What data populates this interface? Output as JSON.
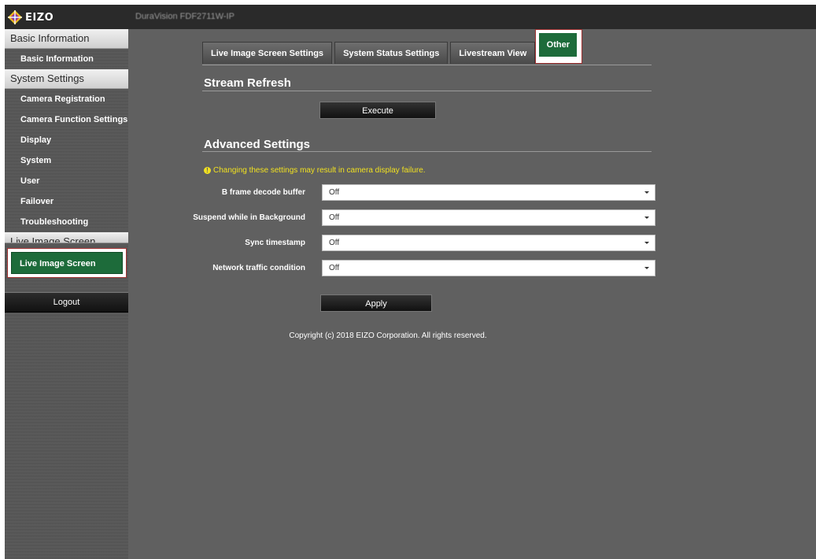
{
  "header": {
    "logo_text": "EIZO",
    "device_name": "DuraVision FDF2711W-IP"
  },
  "sidebar": {
    "sections": [
      {
        "title": "Basic Information",
        "items": [
          "Basic Information"
        ]
      },
      {
        "title": "System Settings",
        "items": [
          "Camera Registration",
          "Camera Function Settings",
          "Display",
          "System",
          "User",
          "Failover",
          "Troubleshooting"
        ]
      },
      {
        "title": "Live Image Screen Settings",
        "items": [
          "Live Image Screen"
        ]
      }
    ],
    "logout_label": "Logout"
  },
  "tabs": [
    "Live Image Screen Settings",
    "System Status Settings",
    "Livestream View",
    "Other"
  ],
  "stream_refresh": {
    "title": "Stream Refresh",
    "execute_label": "Execute"
  },
  "advanced": {
    "title": "Advanced Settings",
    "warning": "Changing these settings may result in camera display failure.",
    "rows": [
      {
        "label": "B frame decode buffer",
        "value": "Off"
      },
      {
        "label": "Suspend while in Background",
        "value": "Off"
      },
      {
        "label": "Sync timestamp",
        "value": "Off"
      },
      {
        "label": "Network traffic condition",
        "value": "Off"
      }
    ],
    "apply_label": "Apply"
  },
  "footer": {
    "copyright": "Copyright (c) 2018 EIZO Corporation. All rights reserved."
  },
  "colors": {
    "accent_green": "#1d6b3a",
    "highlight_red": "#a03030",
    "warning_yellow": "#f0e020"
  }
}
